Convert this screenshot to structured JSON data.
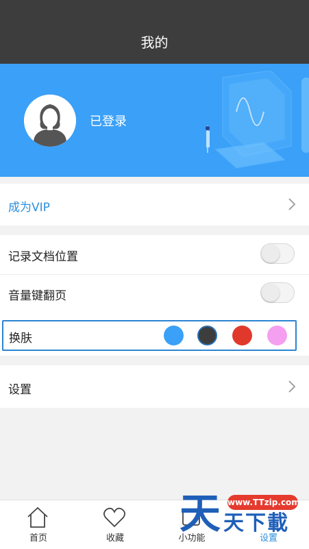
{
  "header": {
    "title": "我的"
  },
  "profile": {
    "status_text": "已登录",
    "avatar_icon": "user-avatar-icon"
  },
  "vip": {
    "label": "成为VIP",
    "color": "#2d8fdc"
  },
  "settings_rows": [
    {
      "label": "记录文档位置",
      "toggle_on": false
    },
    {
      "label": "音量键翻页",
      "toggle_on": false
    }
  ],
  "skin": {
    "label": "换肤",
    "swatches": [
      {
        "name": "blue",
        "color": "#3ba0f7",
        "selected": false
      },
      {
        "name": "dark",
        "color": "#3d3d3d",
        "selected": true
      },
      {
        "name": "red",
        "color": "#e0392c",
        "selected": false
      },
      {
        "name": "pink",
        "color": "#f59ff0",
        "selected": false
      }
    ]
  },
  "settings": {
    "label": "设置"
  },
  "tabbar": {
    "tabs": [
      {
        "label": "首页",
        "icon": "home-icon"
      },
      {
        "label": "收藏",
        "icon": "heart-icon"
      },
      {
        "label": "小功能",
        "icon": "tools-icon"
      },
      {
        "label": "设置",
        "icon": "settings-icon",
        "active": true
      }
    ]
  },
  "watermark": {
    "url": "www.TTzip.com",
    "big": "天",
    "small": "天下載"
  },
  "colors": {
    "header_bg": "#3d3d3d",
    "banner_bg": "#3ba0f7",
    "accent": "#2d8fdc"
  }
}
